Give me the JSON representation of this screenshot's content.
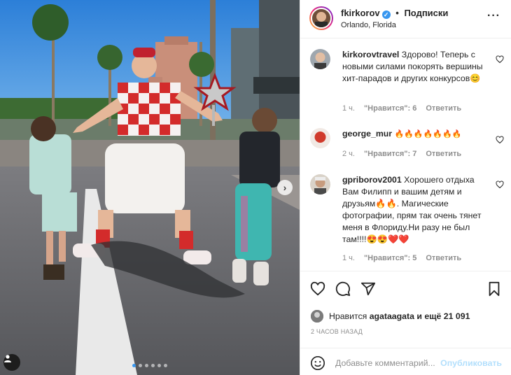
{
  "post": {
    "username": "fkirkorov",
    "separator": "•",
    "follow_label": "Подписки",
    "location": "Orlando, Florida",
    "more_label": "···",
    "carousel_count": 6
  },
  "comments": [
    {
      "username": "kirkorovtravel",
      "text": "Здорово! Теперь с новыми силами покорять вершины хит-парадов и других конкурсов😊",
      "time": "1 ч.",
      "likes": "\"Нравится\": 6",
      "reply": "Ответить"
    },
    {
      "username": "george_mur",
      "text": "🔥🔥🔥🔥🔥🔥🔥",
      "time": "2 ч.",
      "likes": "\"Нравится\": 7",
      "reply": "Ответить"
    },
    {
      "username": "gpriborov2001",
      "text": "Хорошего отдыха Вам Филипп и вашим детям и друзьям🔥🔥. Магические фотографии, прям так очень тянет меня в Флориду.Ни разу не был там!!!!😍😍❤️❤️",
      "time": "1 ч.",
      "likes": "\"Нравится\": 5",
      "reply": "Ответить"
    }
  ],
  "likes_bar": {
    "prefix": "Нравится",
    "user": "agataagata",
    "and_more": "и ещё 21 091"
  },
  "timestamp": "2 ЧАСОВ НАЗАД",
  "comment_box": {
    "placeholder": "Добавьте комментарий...",
    "publish_label": "Опубликовать"
  }
}
